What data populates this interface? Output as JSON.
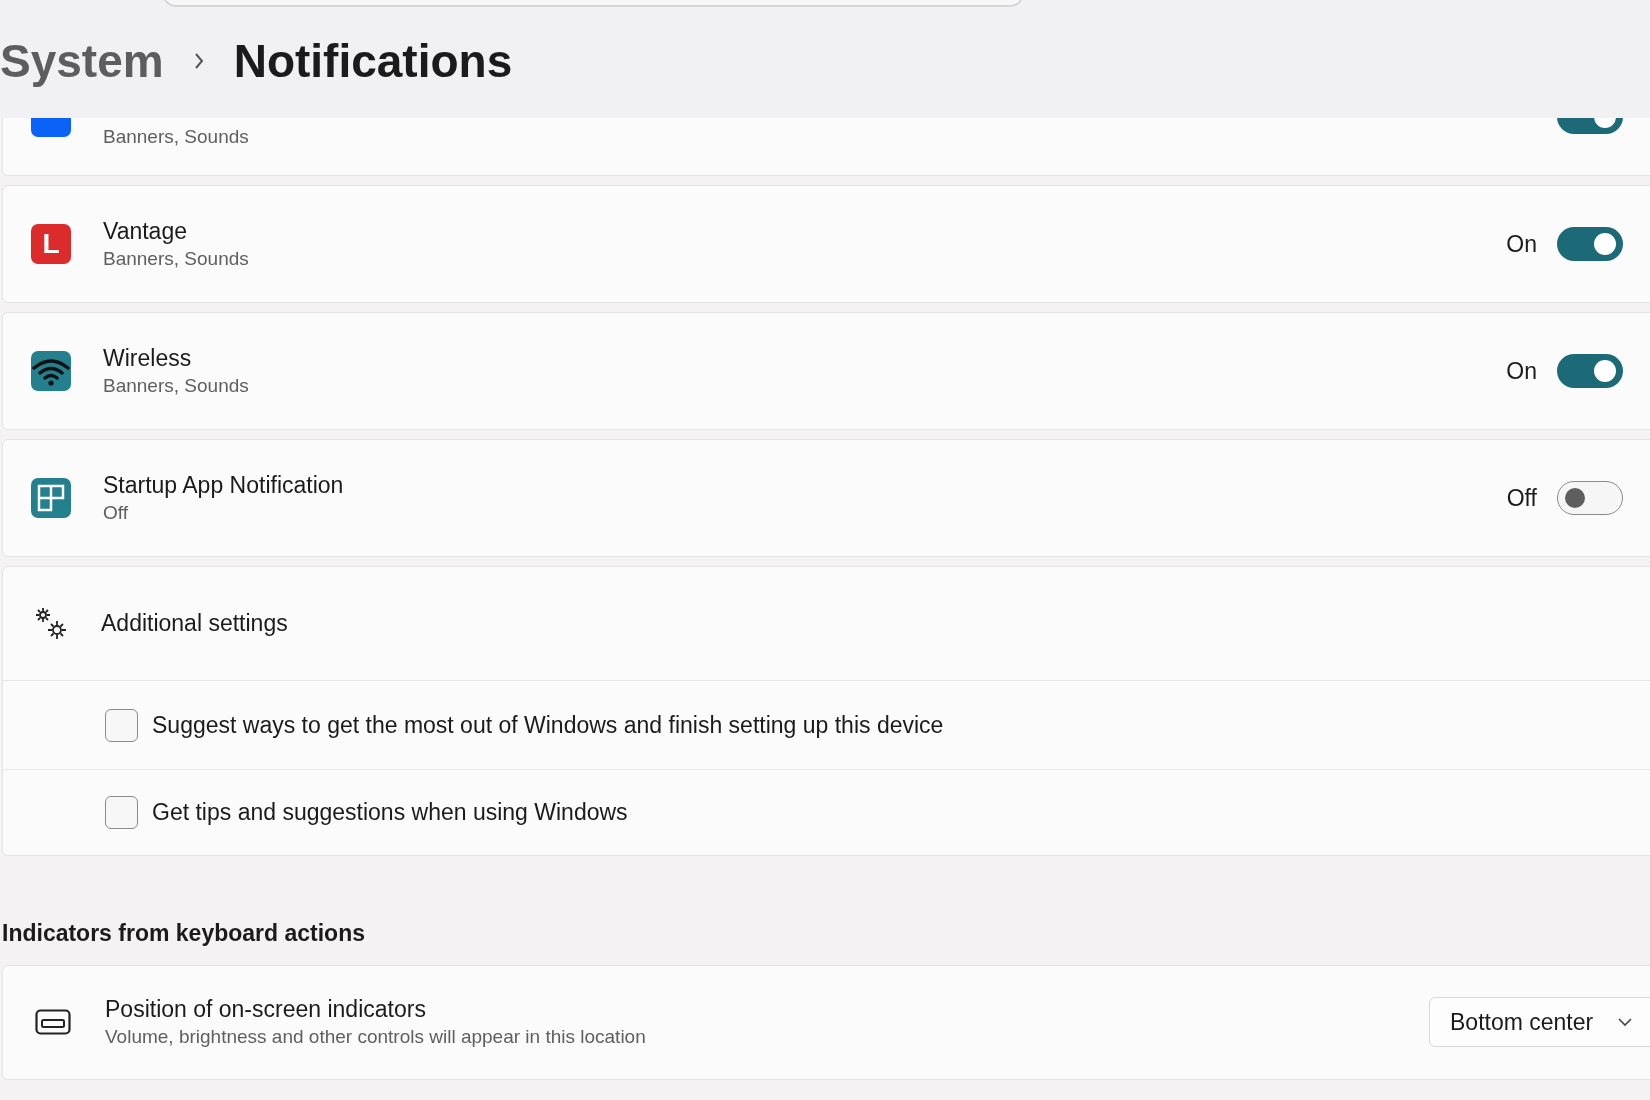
{
  "header": {
    "breadcrumb_parent": "System",
    "page_title": "Notifications"
  },
  "apps": [
    {
      "kind": "dropbox",
      "subtitle": "Banners, Sounds",
      "on": true
    },
    {
      "kind": "letter",
      "icon_letter": "L",
      "title": "Vantage",
      "subtitle": "Banners, Sounds",
      "state_text": "On",
      "on": true
    },
    {
      "kind": "wifi",
      "title": "Wireless",
      "subtitle": "Banners, Sounds",
      "state_text": "On",
      "on": true
    },
    {
      "kind": "grid",
      "title": "Startup App Notification",
      "subtitle": "Off",
      "state_text": "Off",
      "on": false
    }
  ],
  "additional": {
    "title": "Additional settings",
    "expanded": true,
    "options": [
      {
        "label": "Suggest ways to get the most out of Windows and finish setting up this device",
        "checked": false
      },
      {
        "label": "Get tips and suggestions when using Windows",
        "checked": false
      }
    ]
  },
  "section": {
    "heading": "Indicators from keyboard actions",
    "settings": [
      {
        "title": "Position of on-screen indicators",
        "description": "Volume, brightness and other controls will appear in this location",
        "value": "Bottom center"
      }
    ]
  }
}
